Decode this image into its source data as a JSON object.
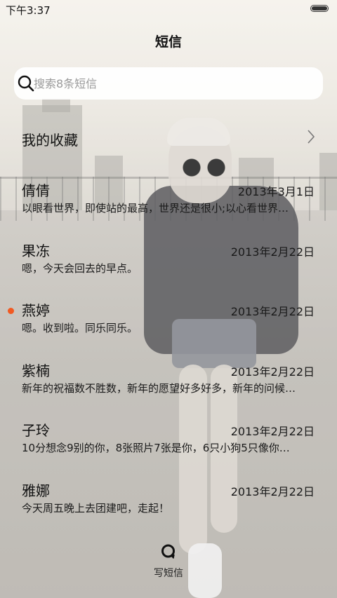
{
  "status_bar": {
    "time": "下午3:37"
  },
  "header": {
    "title": "短信"
  },
  "search": {
    "placeholder": "搜索8条短信",
    "value": ""
  },
  "favorites": {
    "label": "我的收藏"
  },
  "messages": [
    {
      "name": "倩倩",
      "date": "2013年3月1日",
      "preview": "以眼看世界，即使站的最高，世界还是很小;以心看世界…",
      "unread": false
    },
    {
      "name": "果冻",
      "date": "2013年2月22日",
      "preview": "嗯，今天会回去的早点。",
      "unread": false
    },
    {
      "name": "燕婷",
      "date": "2013年2月22日",
      "preview": "嗯。收到啦。同乐同乐。",
      "unread": true
    },
    {
      "name": "紫楠",
      "date": "2013年2月22日",
      "preview": "新年的祝福数不胜数，新年的愿望好多好多，新年的问候…",
      "unread": false
    },
    {
      "name": "子玲",
      "date": "2013年2月22日",
      "preview": "10分想念9别的你，8张照片7张是你，6只小狗5只像你…",
      "unread": false
    },
    {
      "name": "雅娜",
      "date": "2013年2月22日",
      "preview": "今天周五晚上去团建吧，走起！",
      "unread": false
    }
  ],
  "compose": {
    "label": "写短信"
  },
  "colors": {
    "unread_dot": "#f15a22",
    "search_bg": "#ffffff",
    "text": "#111111"
  },
  "icons": {
    "search": "search-icon",
    "chevron": "chevron-right-icon",
    "compose": "compose-icon",
    "battery": "battery-icon"
  }
}
